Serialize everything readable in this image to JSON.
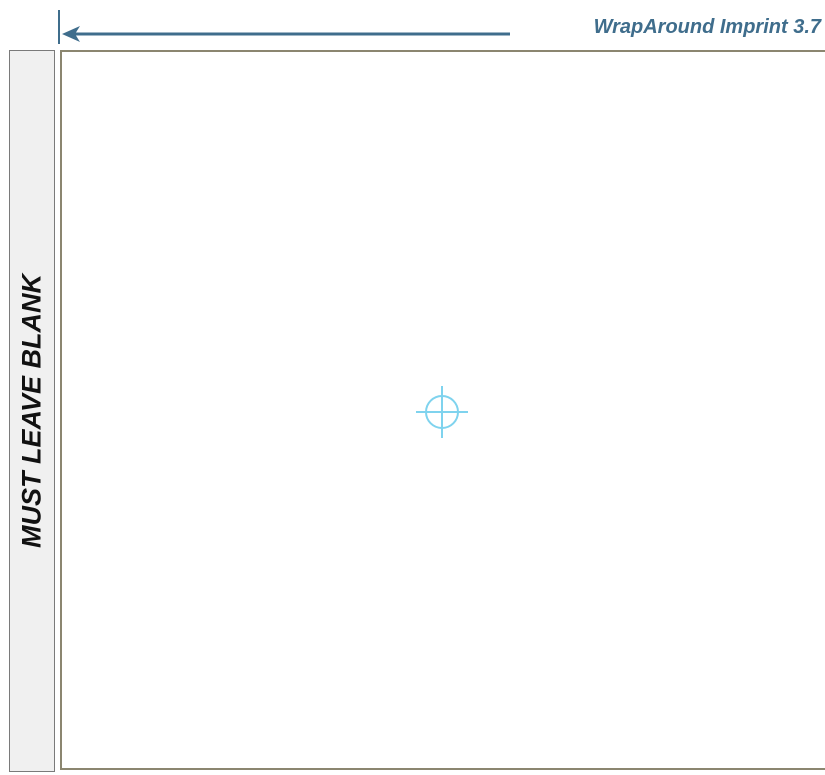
{
  "header": {
    "title": "WrapAround Imprint 3.7"
  },
  "blank_strip": {
    "label": "MUST LEAVE BLANK"
  },
  "icons": {
    "direction": "arrow-left-icon",
    "center": "crosshair-icon"
  },
  "colors": {
    "accent": "#3f6d8c",
    "crosshair": "#7fd3ee",
    "border": "#8b8670",
    "strip_fill": "#f0f0f0"
  }
}
